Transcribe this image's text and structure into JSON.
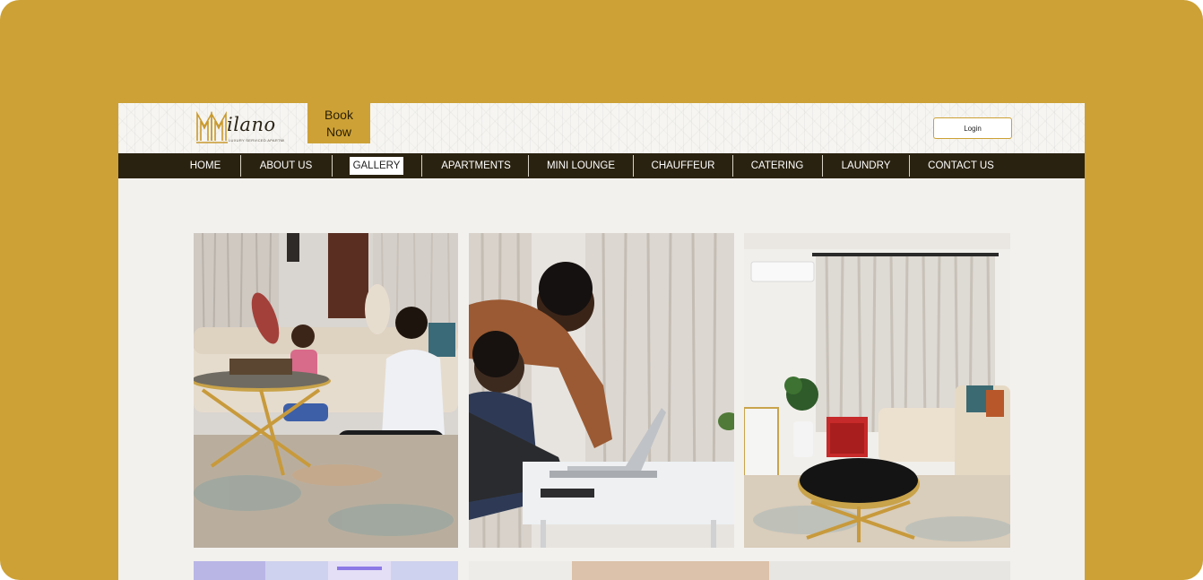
{
  "header": {
    "logo_word": "ilano",
    "logo_tagline": "LUXURY SERVICED APARTMENT",
    "book_now_label": "Book Now",
    "login_label": "Login"
  },
  "nav": {
    "items": [
      {
        "label": "HOME",
        "active": false
      },
      {
        "label": "ABOUT US",
        "active": false
      },
      {
        "label": "GALLERY",
        "active": true
      },
      {
        "label": "APARTMENTS",
        "active": false
      },
      {
        "label": "MINI LOUNGE",
        "active": false
      },
      {
        "label": "CHAUFFEUR",
        "active": false
      },
      {
        "label": "CATERING",
        "active": false
      },
      {
        "label": "LAUNDRY",
        "active": false
      },
      {
        "label": "CONTACT US",
        "active": false
      }
    ]
  },
  "gallery": {
    "photos": [
      {
        "subject": "family-living-room"
      },
      {
        "subject": "men-working-laptop"
      },
      {
        "subject": "living-room-interior"
      },
      {
        "subject": "purple-lit-room"
      },
      {
        "subject": "bedroom-interior"
      }
    ]
  },
  "colors": {
    "brand_gold": "#CDA135",
    "nav_bg": "#2A2210",
    "page_bg": "#F3F1EE"
  }
}
